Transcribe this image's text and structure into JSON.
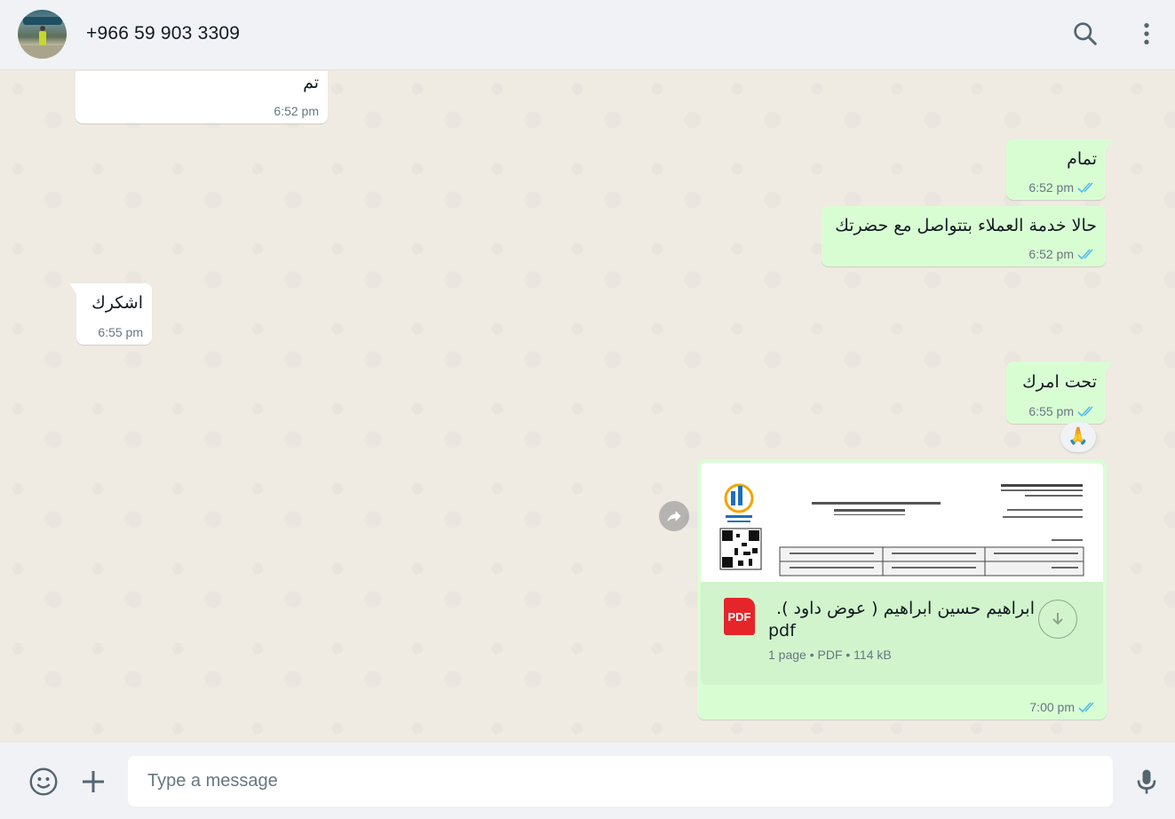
{
  "header": {
    "contact_name": "+966 59 903 3309",
    "icons": [
      "avatar",
      "search-icon",
      "menu-icon"
    ]
  },
  "messages": [
    {
      "direction": "in",
      "text": "تم",
      "time": "6:52 pm"
    },
    {
      "direction": "out",
      "text": "تمام",
      "time": "6:52 pm",
      "status": "read"
    },
    {
      "direction": "out",
      "text": "حالا خدمة العملاء بتتواصل مع حضرتك",
      "time": "6:52 pm",
      "status": "read"
    },
    {
      "direction": "in",
      "text": "اشكرك",
      "time": "6:55 pm"
    },
    {
      "direction": "out",
      "text": "تحت امرك",
      "time": "6:55 pm",
      "status": "read",
      "reaction": "🙏"
    },
    {
      "direction": "out",
      "type": "document",
      "icon_label": "PDF",
      "file_name": "ابراهيم حسين ابراهيم ( عوض داود ).pdf",
      "file_name_line1": "ابراهيم حسين ابراهيم ( عوض داود ).",
      "file_name_line2": "pdf",
      "details": "1 page • PDF • 114 kB",
      "time": "7:00 pm",
      "status": "read"
    }
  ],
  "composer": {
    "placeholder": "Type a message",
    "icons": [
      "emoji-icon",
      "attach-plus-icon",
      "microphone-icon"
    ]
  },
  "colors": {
    "header_bg": "#f0f2f5",
    "chat_bg": "#efeae2",
    "outgoing_bubble": "#d9fdd3",
    "incoming_bubble": "#ffffff",
    "read_ticks": "#53bdeb",
    "pdf_red": "#e5252a"
  }
}
